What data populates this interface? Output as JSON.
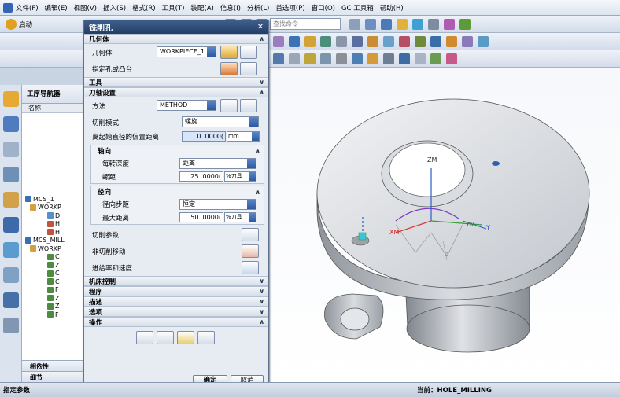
{
  "menubar": {
    "items": [
      "文件(F)",
      "编辑(E)",
      "视图(V)",
      "插入(S)",
      "格式(R)",
      "工具(T)",
      "装配(A)",
      "信息(I)",
      "分析(L)",
      "首选项(P)",
      "窗口(O)",
      "GC 工具箱",
      "帮助(H)"
    ]
  },
  "toolbar": {
    "start_label": "启动",
    "search_placeholder": "查找命令"
  },
  "navigator": {
    "title": "工序导航器",
    "column_name": "名称",
    "rows": [
      "MCS_1",
      "WORKP",
      "D",
      "H",
      "H",
      "MCS_MILL",
      "WORKP",
      "C",
      "Z",
      "C",
      "C",
      "F",
      "Z",
      "Z",
      "F"
    ],
    "bottom": [
      "相依性",
      "细节"
    ]
  },
  "dialog": {
    "title": "铣削孔",
    "sections": {
      "geometry": "几何体",
      "tool": "工具",
      "tool_axis": "刀轴设置",
      "machine_control": "机床控制",
      "program": "程序",
      "description": "描述",
      "options": "选项",
      "actions": "操作"
    },
    "geometry_label": "几何体",
    "geometry_value": "WORKPIECE_1",
    "specify_holes_label": "指定孔或凸台",
    "method_label": "方法",
    "method_value": "METHOD",
    "cut_mode_label": "切削模式",
    "cut_mode_value": "螺旋",
    "offset_label": "离起始直径的偏置距离",
    "offset_value": "0. 0000(",
    "offset_unit": "mm",
    "axial": {
      "title": "轴向",
      "depth_label": "每转深度",
      "depth_value": "距离",
      "pitch_label": "螺距",
      "pitch_value": "25. 0000(",
      "pitch_unit": "%刀具"
    },
    "radial": {
      "title": "径向",
      "step_label": "径向步距",
      "step_value": "恒定",
      "max_label": "最大距离",
      "max_value": "50. 0000(",
      "max_unit": "%刀具"
    },
    "cut_params_label": "切削参数",
    "non_cut_label": "非切削移动",
    "feeds_label": "进给率和速度",
    "ok_label": "确定",
    "cancel_label": "取消"
  },
  "viewport": {
    "axis_zm": "ZM",
    "axis_xm": "XM",
    "axis_ym": "YM",
    "axis_z": "Z",
    "axis_y": "Y"
  },
  "status": {
    "left": "指定参数",
    "right": "当前：HOLE_MILLING"
  },
  "colors": {
    "title_bar": "#2d4b77",
    "accent_blue": "#2d5aa0",
    "part_gray": "#bfc4cb"
  }
}
